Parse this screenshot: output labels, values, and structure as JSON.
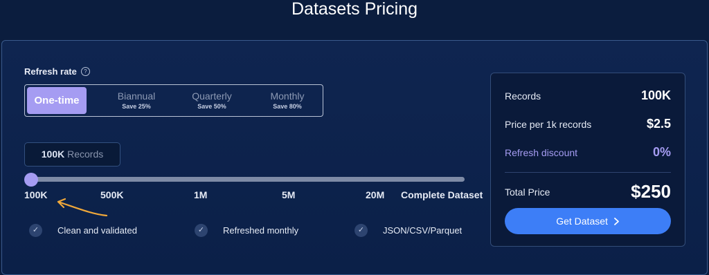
{
  "page_title": "Datasets Pricing",
  "refresh": {
    "label": "Refresh rate",
    "tabs": [
      {
        "title": "One-time",
        "save": ""
      },
      {
        "title": "Biannual",
        "save": "Save 25%"
      },
      {
        "title": "Quarterly",
        "save": "Save 50%"
      },
      {
        "title": "Monthly",
        "save": "Save 80%"
      }
    ],
    "selected": "One-time"
  },
  "records": {
    "value": "100K",
    "unit": "Records"
  },
  "slider": {
    "ticks": [
      "100K",
      "500K",
      "1M",
      "5M",
      "20M",
      "Complete Dataset"
    ],
    "selected_index": 0
  },
  "features": [
    "Clean and validated",
    "Refreshed monthly",
    "JSON/CSV/Parquet"
  ],
  "summary": {
    "records_label": "Records",
    "records_value": "100K",
    "price_label": "Price per 1k records",
    "price_value": "$2.5",
    "discount_label": "Refresh discount",
    "discount_value": "0%",
    "total_label": "Total Price",
    "total_value": "$250",
    "cta_label": "Get Dataset",
    "cta_icon": "chevron-right-icon"
  },
  "colors": {
    "background": "#0b1d3e",
    "accent_purple": "#a59cf2",
    "button_blue": "#3d7ef7",
    "annotation_arrow": "#f0a83a"
  }
}
